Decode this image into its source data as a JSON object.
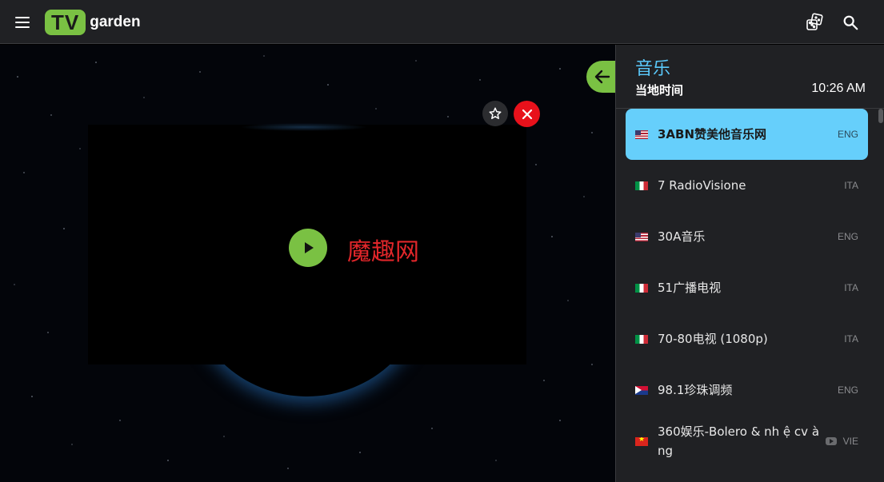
{
  "header": {
    "logo_badge": "TV",
    "logo_text": "garden",
    "menu_icon": "hamburger-menu-icon",
    "random_icon": "dice-icon",
    "search_icon": "search-icon"
  },
  "player": {
    "watermark": "魔趣网",
    "play_icon": "play-icon",
    "favorite_icon": "star-icon",
    "close_icon": "close-icon",
    "back_icon": "arrow-left-icon"
  },
  "panel": {
    "title": "音乐",
    "time_label": "当地时间",
    "time_value": "10:26 AM",
    "channels": [
      {
        "name": "3ABN赞美他音乐网",
        "lang": "ENG",
        "flag": "us",
        "active": true
      },
      {
        "name": "7 RadioVisione",
        "lang": "ITA",
        "flag": "it"
      },
      {
        "name": "30A音乐",
        "lang": "ENG",
        "flag": "us"
      },
      {
        "name": "51广播电视",
        "lang": "ITA",
        "flag": "it"
      },
      {
        "name": "70-80电视 (1080p)",
        "lang": "ITA",
        "flag": "it"
      },
      {
        "name": "98.1珍珠调频",
        "lang": "ENG",
        "flag": "sx"
      },
      {
        "name": "360娱乐-Bolero & nh ệ cv à ng",
        "lang": "VIE",
        "flag": "vn",
        "youtube": true
      }
    ]
  },
  "colors": {
    "accent_green": "#7ac143",
    "active_blue": "#66cffb",
    "title_blue": "#5ac8fa",
    "close_red": "#e8111b",
    "panel_bg": "#202124"
  }
}
